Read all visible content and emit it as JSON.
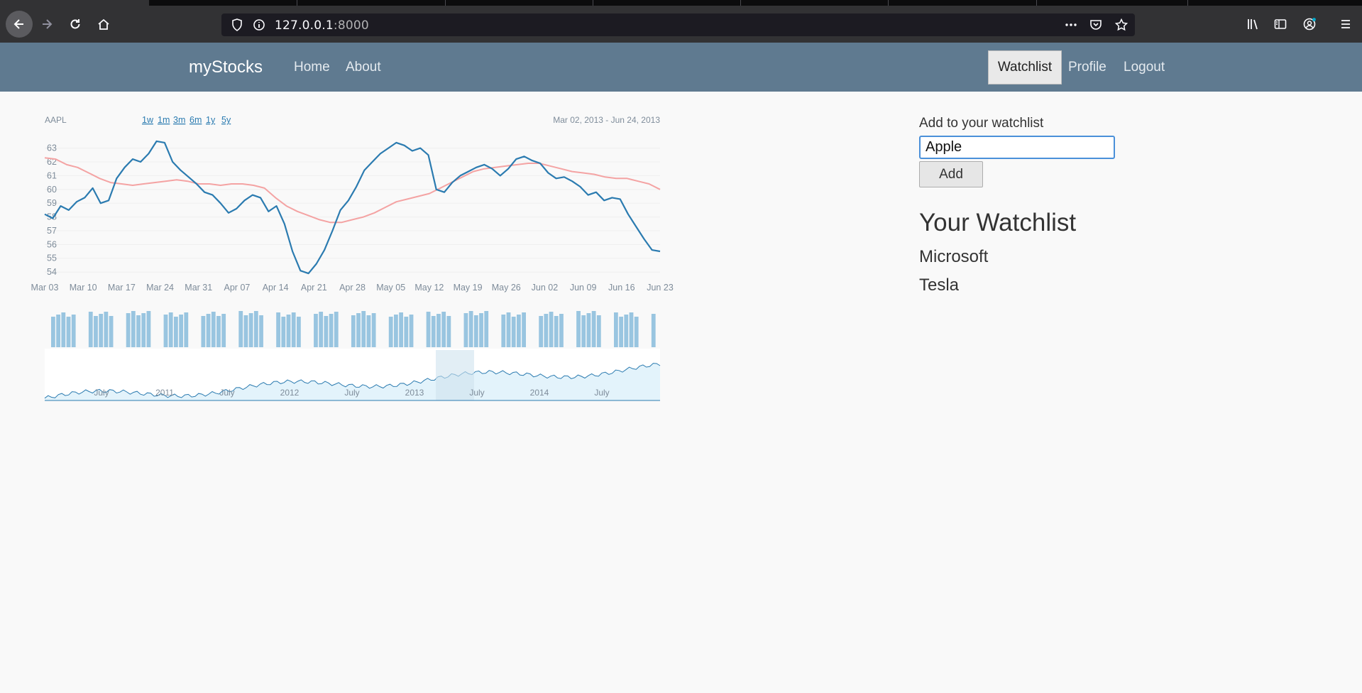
{
  "browser": {
    "url_host": "127.0.0.1",
    "url_port": ":8000",
    "icons": [
      "back-arrow-icon",
      "forward-arrow-icon",
      "reload-icon",
      "home-icon",
      "shield-icon",
      "info-icon",
      "more-icon",
      "pocket-icon",
      "star-icon",
      "library-icon",
      "sidebar-icon",
      "account-icon",
      "menu-icon"
    ]
  },
  "navbar": {
    "brand": "myStocks",
    "links": {
      "home": "Home",
      "about": "About",
      "watchlist": "Watchlist",
      "profile": "Profile",
      "logout": "Logout"
    }
  },
  "chart": {
    "symbol": "AAPL",
    "ranges": [
      "1w",
      "1m",
      "3m",
      "6m",
      "1y",
      "5y"
    ],
    "date_range": "Mar 02, 2013 - Jun 24, 2013"
  },
  "chart_data": {
    "type": "line",
    "colors": {
      "price": "#2b7bb0",
      "average": "#f4a3a3",
      "volume": "#99c5e0",
      "navigator": "#e3f3fb"
    },
    "yticks": [
      54,
      55,
      56,
      57,
      58,
      59,
      60,
      61,
      62,
      63
    ],
    "xticks": [
      "Mar 03",
      "Mar 10",
      "Mar 17",
      "Mar 24",
      "Mar 31",
      "Apr 07",
      "Apr 14",
      "Apr 21",
      "Apr 28",
      "May 05",
      "May 12",
      "May 19",
      "May 26",
      "Jun 02",
      "Jun 09",
      "Jun 16",
      "Jun 23"
    ],
    "ylim": [
      53.8,
      63.6
    ],
    "series": [
      {
        "values": [
          58.2,
          57.9,
          58.8,
          58.5,
          59.1,
          59.4,
          60.1,
          59.0,
          59.2,
          60.8,
          61.6,
          62.2,
          62.0,
          62.6,
          63.5,
          63.4,
          62.0,
          61.4,
          60.9,
          60.4,
          59.8,
          59.6,
          59.0,
          58.3,
          58.6,
          59.2,
          59.6,
          59.4,
          58.4,
          58.8,
          57.5,
          55.5,
          54.1,
          53.9,
          54.6,
          55.6,
          57.0,
          58.5,
          59.2,
          60.2,
          61.4,
          62.0,
          62.6,
          63.0,
          63.4,
          63.2,
          62.8,
          63.0,
          62.5,
          60.0,
          59.8,
          60.5,
          61.0,
          61.3,
          61.6,
          61.8,
          61.5,
          61.0,
          61.5,
          62.2,
          62.4,
          62.1,
          61.9,
          61.2,
          60.8,
          60.9,
          60.6,
          60.2,
          59.6,
          59.8,
          59.2,
          59.4,
          59.3,
          58.2,
          57.3,
          56.4,
          55.6,
          55.5
        ]
      },
      {
        "values": [
          62.3,
          62.2,
          61.8,
          61.6,
          61.2,
          60.8,
          60.5,
          60.4,
          60.3,
          60.4,
          60.5,
          60.6,
          60.7,
          60.6,
          60.4,
          60.4,
          60.3,
          60.4,
          60.4,
          60.3,
          60.1,
          59.4,
          58.8,
          58.4,
          58.1,
          57.8,
          57.6,
          57.6,
          57.8,
          58.0,
          58.3,
          58.7,
          59.1,
          59.3,
          59.5,
          59.7,
          60.1,
          60.5,
          60.9,
          61.3,
          61.5,
          61.6,
          61.7,
          61.8,
          61.9,
          61.9,
          61.7,
          61.5,
          61.3,
          61.2,
          61.1,
          60.9,
          60.8,
          60.8,
          60.6,
          60.4,
          60.0
        ]
      }
    ],
    "navigator_xticks": [
      "July",
      "2011",
      "July",
      "2012",
      "July",
      "2013",
      "July",
      "2014",
      "July"
    ]
  },
  "watchlist_form": {
    "label": "Add to your watchlist",
    "value": "Apple",
    "button": "Add"
  },
  "watchlist": {
    "title": "Your Watchlist",
    "items": [
      "Microsoft",
      "Tesla"
    ]
  }
}
